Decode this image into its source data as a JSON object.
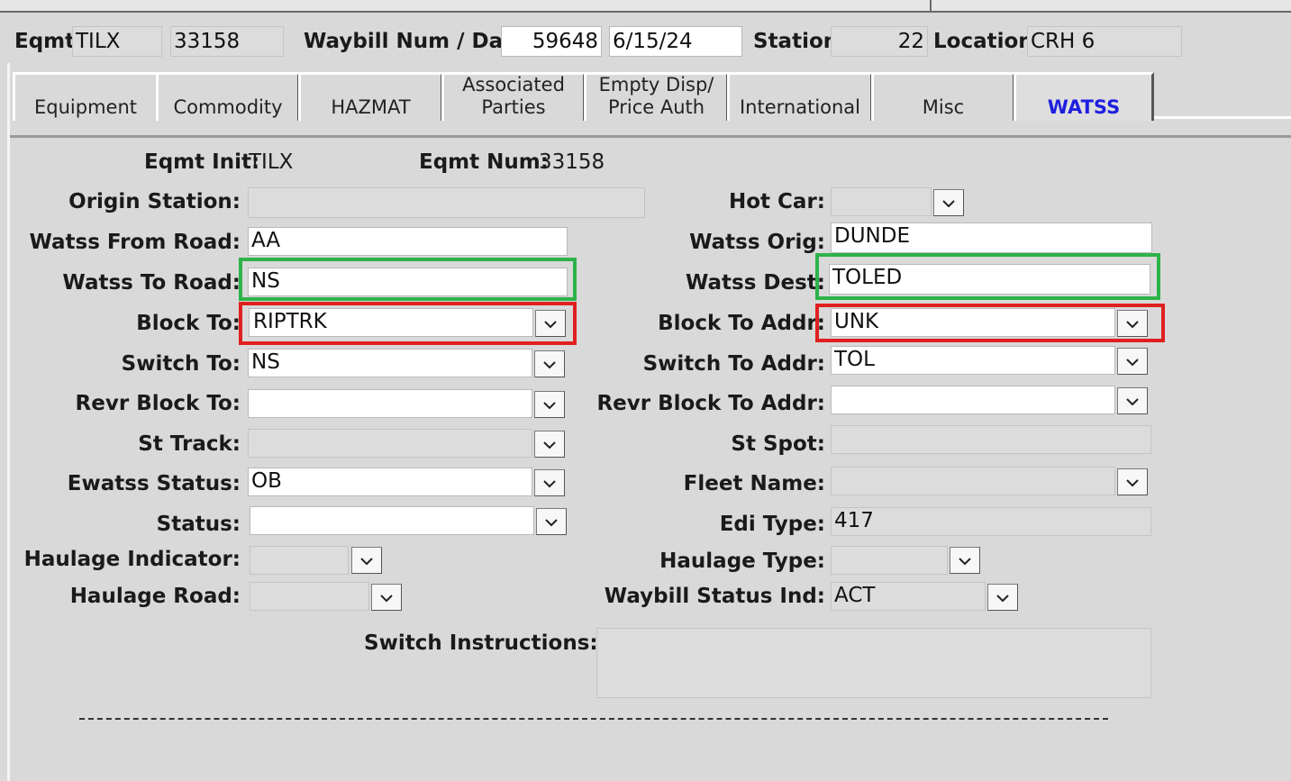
{
  "header": {
    "eqmt_label": "Eqmt",
    "eqmt_init": "TILX",
    "eqmt_num": "33158",
    "waybill_label": "Waybill Num / Date",
    "waybill_num": "59648",
    "waybill_date": "6/15/24",
    "station_label": "Station",
    "station_value": "22",
    "location_label": "Location",
    "location_value": "CRH 6"
  },
  "tabs": [
    {
      "label": "Equipment"
    },
    {
      "label": "Commodity"
    },
    {
      "label": "HAZMAT"
    },
    {
      "label": "Associated\nParties"
    },
    {
      "label": "Empty Disp/\nPrice Auth"
    },
    {
      "label": "International"
    },
    {
      "label": "Misc"
    },
    {
      "label": "WATSS"
    }
  ],
  "form": {
    "eqmt_init_label": "Eqmt Init:",
    "eqmt_init_value": "TILX",
    "eqmt_num_label": "Eqmt Num:",
    "eqmt_num_value": "33158",
    "origin_station_label": "Origin Station:",
    "origin_station_value": "",
    "hot_car_label": "Hot Car:",
    "hot_car_value": "",
    "watss_from_road_label": "Watss From Road:",
    "watss_from_road_value": "AA",
    "watss_orig_label": "Watss Orig:",
    "watss_orig_value": "DUNDE",
    "watss_to_road_label": "Watss To Road:",
    "watss_to_road_value": "NS",
    "watss_dest_label": "Watss Dest:",
    "watss_dest_value": "TOLED",
    "block_to_label": "Block To:",
    "block_to_value": "RIPTRK",
    "block_to_addr_label": "Block To Addr:",
    "block_to_addr_value": "UNK",
    "switch_to_label": "Switch To:",
    "switch_to_value": "NS",
    "switch_to_addr_label": "Switch To Addr:",
    "switch_to_addr_value": "TOL",
    "revr_block_to_label": "Revr Block To:",
    "revr_block_to_value": "",
    "revr_block_to_addr_label": "Revr Block To Addr:",
    "revr_block_to_addr_value": "",
    "st_track_label": "St Track:",
    "st_track_value": "",
    "st_spot_label": "St Spot:",
    "st_spot_value": "",
    "ewatss_status_label": "Ewatss Status:",
    "ewatss_status_value": "OB",
    "fleet_name_label": "Fleet Name:",
    "fleet_name_value": "",
    "status_label": "Status:",
    "status_value": "",
    "edi_type_label": "Edi Type:",
    "edi_type_value": "417",
    "haulage_indicator_label": "Haulage Indicator:",
    "haulage_indicator_value": "",
    "haulage_type_label": "Haulage Type:",
    "haulage_type_value": "",
    "haulage_road_label": "Haulage Road:",
    "haulage_road_value": "",
    "waybill_status_ind_label": "Waybill Status Ind:",
    "waybill_status_ind_value": "ACT",
    "switch_instructions_label": "Switch Instructions:",
    "switch_instructions_value": ""
  },
  "colors": {
    "highlight_green": "#2db34a",
    "highlight_red": "#e02020",
    "active_tab_text": "#1f1fe0"
  },
  "icons": {
    "dropdown": "chevron-down-icon"
  }
}
